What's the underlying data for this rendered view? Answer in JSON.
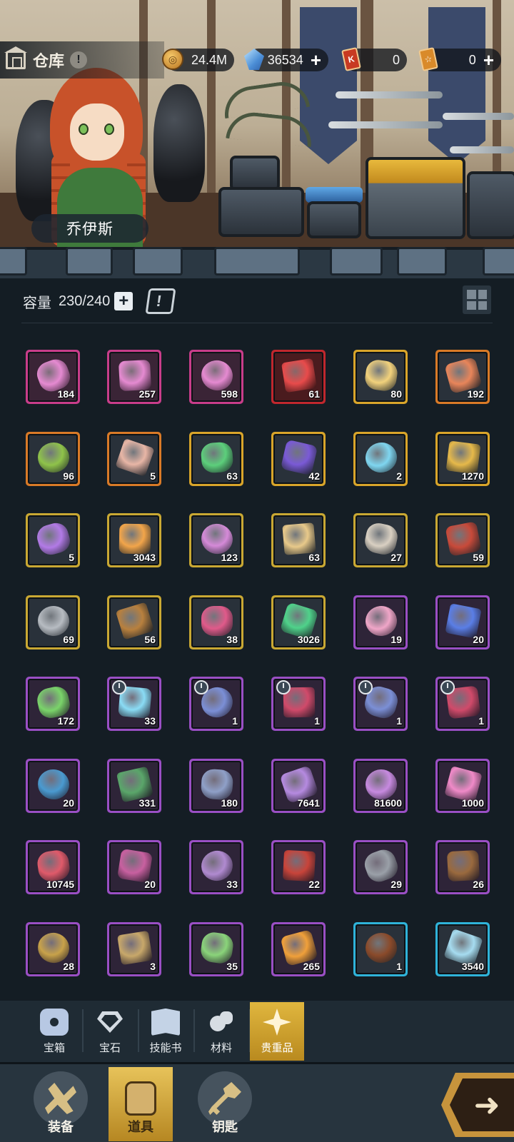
{
  "header": {
    "title": "仓库",
    "info": "!",
    "resources": [
      {
        "name": "gold-coin",
        "value": "24.4M",
        "has_plus": false
      },
      {
        "name": "diamond",
        "value": "36534",
        "has_plus": true
      },
      {
        "name": "red-ticket",
        "value": "0",
        "has_plus": false
      },
      {
        "name": "gold-ticket",
        "value": "0",
        "has_plus": true
      }
    ],
    "plus": "+"
  },
  "hero": {
    "name": "乔伊斯"
  },
  "capacity": {
    "label": "容量",
    "value": "230/240",
    "plus": "+"
  },
  "items": [
    {
      "q": "184",
      "frame": "pink",
      "icon": "pink-crystal-sword-icon",
      "c": "#e58ad1"
    },
    {
      "q": "257",
      "frame": "pink",
      "icon": "pink-crystal-ring-icon",
      "c": "#e58ad1"
    },
    {
      "q": "598",
      "frame": "pink",
      "icon": "pink-crystal-armor-icon",
      "c": "#e58ad1"
    },
    {
      "q": "61",
      "frame": "red",
      "icon": "red-crystal-icon",
      "c": "#e84b4b"
    },
    {
      "q": "80",
      "frame": "gold",
      "icon": "winged-halo-icon",
      "c": "#f2d27c"
    },
    {
      "q": "192",
      "frame": "orange",
      "icon": "coral-icon",
      "c": "#e8855a"
    },
    {
      "q": "96",
      "frame": "orange",
      "icon": "seed-pouch-icon",
      "c": "#8fc34a"
    },
    {
      "q": "5",
      "frame": "orange",
      "icon": "scroll-icon",
      "c": "#e8b6a6"
    },
    {
      "q": "63",
      "frame": "gold",
      "icon": "green-potion-icon",
      "c": "#5ccf7b"
    },
    {
      "q": "42",
      "frame": "gold",
      "icon": "hourglass-icon",
      "c": "#7a5ad6"
    },
    {
      "q": "2",
      "frame": "gold",
      "icon": "crystal-orb-icon",
      "c": "#7fd6f0"
    },
    {
      "q": "1270",
      "frame": "gold",
      "icon": "gold-crest-icon",
      "c": "#e6b94a"
    },
    {
      "q": "5",
      "frame": "yellow",
      "icon": "spiked-star-icon",
      "c": "#b27ae6"
    },
    {
      "q": "3043",
      "frame": "yellow",
      "icon": "orange-star-icon",
      "c": "#f2a54a"
    },
    {
      "q": "123",
      "frame": "yellow",
      "icon": "pink-cookie-icon",
      "c": "#d58ad8"
    },
    {
      "q": "63",
      "frame": "yellow",
      "icon": "cloth-sheet-icon",
      "c": "#e8c98a"
    },
    {
      "q": "27",
      "frame": "yellow",
      "icon": "bandage-roll-icon",
      "c": "#d9d0c2"
    },
    {
      "q": "59",
      "frame": "yellow",
      "icon": "red-leather-icon",
      "c": "#c84a3a"
    },
    {
      "q": "69",
      "frame": "yellow",
      "icon": "iron-ingot-icon",
      "c": "#b7bcc2"
    },
    {
      "q": "56",
      "frame": "yellow",
      "icon": "brown-envelope-icon",
      "c": "#b8803e"
    },
    {
      "q": "38",
      "frame": "yellow",
      "icon": "gem-cluster-icon",
      "c": "#e05a8a"
    },
    {
      "q": "3026",
      "frame": "yellow",
      "icon": "green-flask-icon",
      "c": "#4fd28a"
    },
    {
      "q": "19",
      "frame": "purple",
      "icon": "cupcake-icon",
      "c": "#f0a6c8"
    },
    {
      "q": "20",
      "frame": "purple",
      "icon": "blue-scroll-icon",
      "c": "#5a7ee6"
    },
    {
      "q": "172",
      "frame": "purple",
      "icon": "green-map-icon",
      "c": "#7ad46a"
    },
    {
      "q": "33",
      "frame": "purple",
      "icon": "glowing-sword-icon",
      "c": "#8adcf5",
      "clock": true
    },
    {
      "q": "1",
      "frame": "purple",
      "icon": "blue-gem-key-icon",
      "c": "#7b8fd6",
      "clock": true
    },
    {
      "q": "1",
      "frame": "purple",
      "icon": "red-gem-key-icon",
      "c": "#d04a6a",
      "clock": true
    },
    {
      "q": "1",
      "frame": "purple",
      "icon": "blue-gem-key-icon",
      "c": "#7b8fd6",
      "clock": true
    },
    {
      "q": "1",
      "frame": "purple",
      "icon": "red-gem-key-icon",
      "c": "#d04a6a",
      "clock": true
    },
    {
      "q": "20",
      "frame": "purple",
      "icon": "blue-map-icon",
      "c": "#4a9ad0"
    },
    {
      "q": "331",
      "frame": "purple",
      "icon": "green-bowl-icon",
      "c": "#5aa66a"
    },
    {
      "q": "180",
      "frame": "purple",
      "icon": "stone-ring-icon",
      "c": "#8fa0c8"
    },
    {
      "q": "7641",
      "frame": "purple",
      "icon": "purple-shard-icon",
      "c": "#b58ae0"
    },
    {
      "q": "81600",
      "frame": "purple",
      "icon": "purple-crystal-icon",
      "c": "#c78ae0"
    },
    {
      "q": "1000",
      "frame": "purple",
      "icon": "pink-gem-icon",
      "c": "#f08ac8"
    },
    {
      "q": "10745",
      "frame": "purple",
      "icon": "gem-pile-icon",
      "c": "#e05a6a"
    },
    {
      "q": "20",
      "frame": "purple",
      "icon": "pink-fabric-icon",
      "c": "#c860a0"
    },
    {
      "q": "33",
      "frame": "purple",
      "icon": "purple-yarn-icon",
      "c": "#b08ad0"
    },
    {
      "q": "22",
      "frame": "purple",
      "icon": "red-cloth-icon",
      "c": "#c8443a"
    },
    {
      "q": "29",
      "frame": "purple",
      "icon": "grey-ore-icon",
      "c": "#9aa0a8"
    },
    {
      "q": "26",
      "frame": "purple",
      "icon": "leather-envelope-icon",
      "c": "#9a6a3e"
    },
    {
      "q": "28",
      "frame": "purple",
      "icon": "cube-pile-icon",
      "c": "#c8a24a"
    },
    {
      "q": "3",
      "frame": "purple",
      "icon": "mystery-box-icon",
      "c": "#c8a86a"
    },
    {
      "q": "35",
      "frame": "purple",
      "icon": "green-recipe-icon",
      "c": "#8ad47a"
    },
    {
      "q": "265",
      "frame": "purple",
      "icon": "fire-orb-icon",
      "c": "#f0a03a"
    },
    {
      "q": "1",
      "frame": "cyan",
      "icon": "chocolate-icon",
      "c": "#8a4a2a"
    },
    {
      "q": "3540",
      "frame": "cyan",
      "icon": "ice-crystal-icon",
      "c": "#a6dcf0"
    }
  ],
  "categories": [
    {
      "label": "宝箱",
      "icon": "chest-icon",
      "active": false
    },
    {
      "label": "宝石",
      "icon": "gem-icon",
      "active": false
    },
    {
      "label": "技能书",
      "icon": "book-icon",
      "active": false
    },
    {
      "label": "材料",
      "icon": "material-icon",
      "active": false
    },
    {
      "label": "贵重品",
      "icon": "star-icon",
      "active": true
    }
  ],
  "nav": [
    {
      "label": "装备",
      "icon": "crossed-weapons-icon",
      "active": false
    },
    {
      "label": "道具",
      "icon": "bag-icon",
      "active": true
    },
    {
      "label": "钥匙",
      "icon": "key-icon",
      "active": false
    }
  ],
  "next_glyph": "➜"
}
